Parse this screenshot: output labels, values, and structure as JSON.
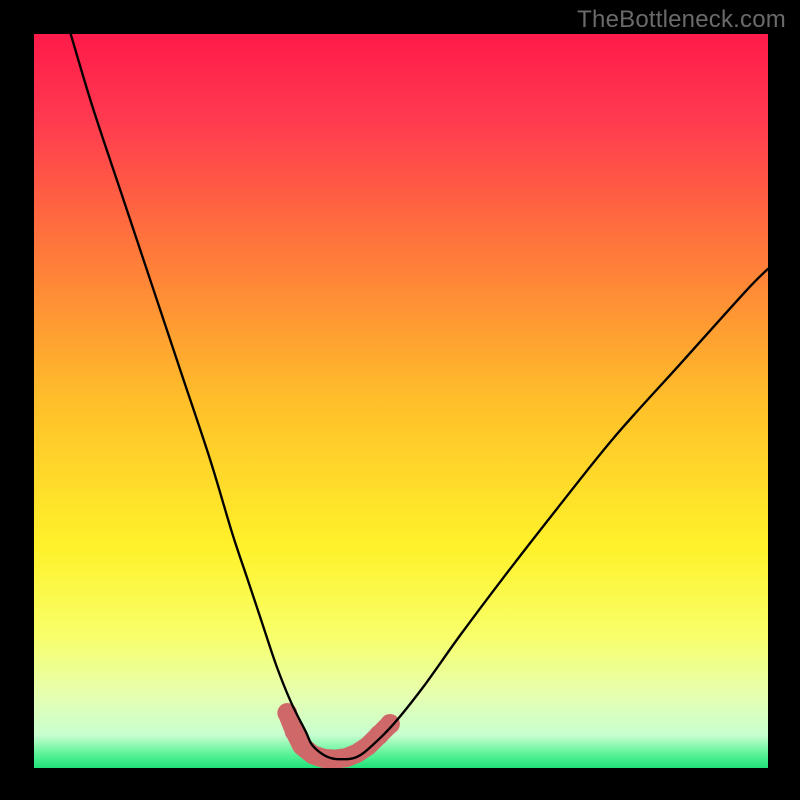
{
  "watermark": {
    "text": "TheBottleneck.com"
  },
  "colors": {
    "frame": "#000000",
    "curve": "#000000",
    "marker": "#cf6868",
    "green_band": "#22e07a",
    "gradient_stops": [
      {
        "offset": 0.0,
        "color": "#ff1a4a"
      },
      {
        "offset": 0.12,
        "color": "#ff3b4f"
      },
      {
        "offset": 0.3,
        "color": "#ff7a3a"
      },
      {
        "offset": 0.5,
        "color": "#ffbf2a"
      },
      {
        "offset": 0.7,
        "color": "#fff22a"
      },
      {
        "offset": 0.82,
        "color": "#f8ff6a"
      },
      {
        "offset": 0.9,
        "color": "#e6ffb0"
      },
      {
        "offset": 0.955,
        "color": "#c8ffd0"
      },
      {
        "offset": 0.985,
        "color": "#4cf090"
      },
      {
        "offset": 1.0,
        "color": "#22e07a"
      }
    ]
  },
  "chart_data": {
    "type": "line",
    "title": "",
    "xlabel": "",
    "ylabel": "",
    "xlim": [
      0,
      100
    ],
    "ylim": [
      0,
      100
    ],
    "grid": false,
    "legend": false,
    "series": [
      {
        "name": "bottleneck-curve",
        "x": [
          5,
          8,
          12,
          16,
          20,
          24,
          27,
          29,
          31,
          33,
          35,
          37,
          38,
          40,
          42,
          44,
          46,
          49,
          53,
          58,
          64,
          71,
          79,
          88,
          97,
          100
        ],
        "y": [
          100,
          90,
          78,
          66,
          54,
          42,
          32,
          26,
          20,
          14,
          9,
          5,
          3,
          1.5,
          1.2,
          1.5,
          3,
          6,
          11,
          18,
          26,
          35,
          45,
          55,
          65,
          68
        ]
      }
    ],
    "markers": {
      "name": "bottom-cluster",
      "color": "#cf6868",
      "points": [
        {
          "x": 34.5,
          "y": 7.5
        },
        {
          "x": 35.5,
          "y": 5.0
        },
        {
          "x": 36.5,
          "y": 3.0
        },
        {
          "x": 38.0,
          "y": 1.8
        },
        {
          "x": 39.5,
          "y": 1.3
        },
        {
          "x": 41.0,
          "y": 1.2
        },
        {
          "x": 42.5,
          "y": 1.4
        },
        {
          "x": 44.0,
          "y": 2.0
        },
        {
          "x": 45.5,
          "y": 3.0
        },
        {
          "x": 47.0,
          "y": 4.5
        },
        {
          "x": 48.5,
          "y": 6.0
        }
      ]
    }
  }
}
